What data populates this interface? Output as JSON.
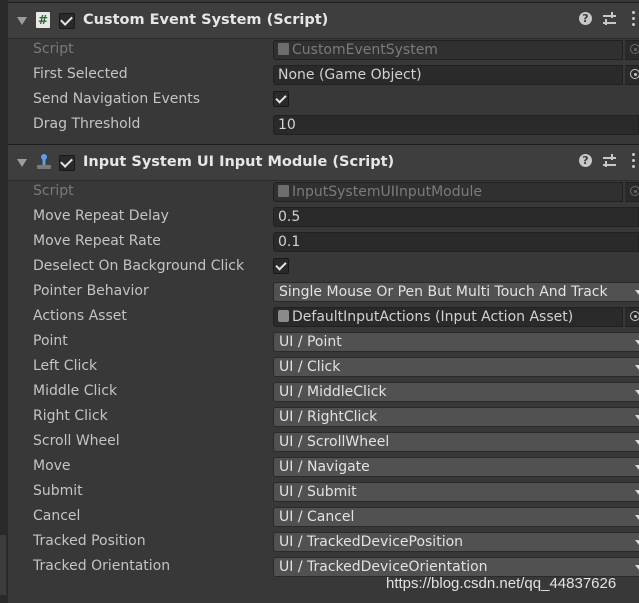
{
  "component1": {
    "title": "Custom Event System (Script)",
    "enabled": true,
    "fields": {
      "script": {
        "label": "Script",
        "value": "CustomEventSystem"
      },
      "first_selected": {
        "label": "First Selected",
        "value": "None (Game Object)"
      },
      "send_navigation_events": {
        "label": "Send Navigation Events",
        "checked": true
      },
      "drag_threshold": {
        "label": "Drag Threshold",
        "value": "10"
      }
    }
  },
  "component2": {
    "title": "Input System UI Input Module (Script)",
    "enabled": true,
    "fields": {
      "script": {
        "label": "Script",
        "value": "InputSystemUIInputModule"
      },
      "move_repeat_delay": {
        "label": "Move Repeat Delay",
        "value": "0.5"
      },
      "move_repeat_rate": {
        "label": "Move Repeat Rate",
        "value": "0.1"
      },
      "deselect_on_background_click": {
        "label": "Deselect On Background Click",
        "checked": true
      },
      "pointer_behavior": {
        "label": "Pointer Behavior",
        "value": "Single Mouse Or Pen But Multi Touch And Track"
      },
      "actions_asset": {
        "label": "Actions Asset",
        "value": "DefaultInputActions (Input Action Asset)"
      },
      "point": {
        "label": "Point",
        "value": "UI / Point"
      },
      "left_click": {
        "label": "Left Click",
        "value": "UI / Click"
      },
      "middle_click": {
        "label": "Middle Click",
        "value": "UI / MiddleClick"
      },
      "right_click": {
        "label": "Right Click",
        "value": "UI / RightClick"
      },
      "scroll_wheel": {
        "label": "Scroll Wheel",
        "value": "UI / ScrollWheel"
      },
      "move": {
        "label": "Move",
        "value": "UI / Navigate"
      },
      "submit": {
        "label": "Submit",
        "value": "UI / Submit"
      },
      "cancel": {
        "label": "Cancel",
        "value": "UI / Cancel"
      },
      "tracked_position": {
        "label": "Tracked Position",
        "value": "UI / TrackedDevicePosition"
      },
      "tracked_orientation": {
        "label": "Tracked Orientation",
        "value": "UI / TrackedDeviceOrientation"
      }
    }
  },
  "header_icons": {
    "help": "?",
    "presets": "presets-icon",
    "more": "more-icon"
  },
  "watermark": "https://blog.csdn.net/qq_44837626",
  "colors": {
    "background": "#383838",
    "header": "#3e3e3e",
    "field": "#2a2a2a",
    "dropdown": "#515151"
  }
}
